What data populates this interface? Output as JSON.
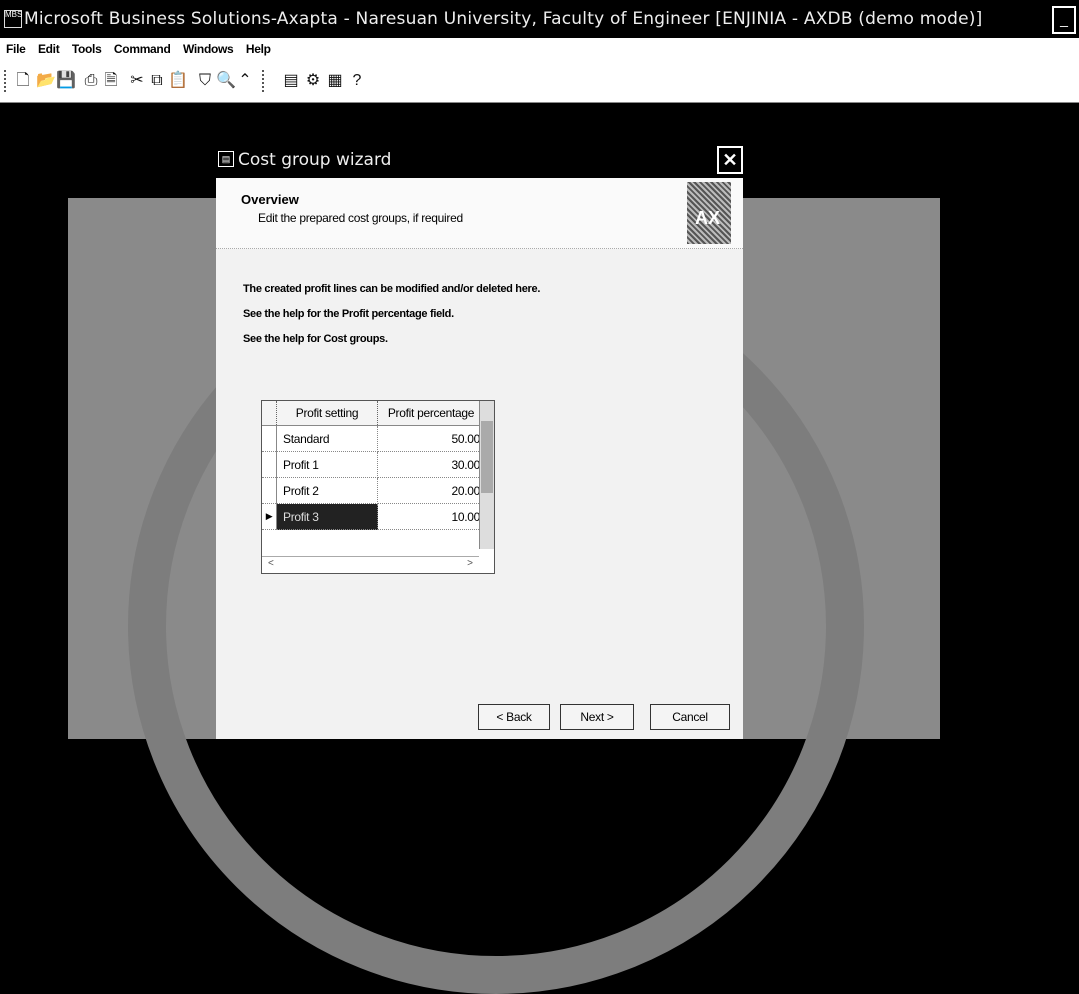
{
  "window": {
    "title": "Microsoft Business Solutions-Axapta - Naresuan University, Faculty of Engineer [ENJINIA - AXDB (demo mode)]",
    "icon_text": "MBS"
  },
  "menu": [
    "File",
    "Edit",
    "Tools",
    "Command",
    "Windows",
    "Help"
  ],
  "toolbar": {
    "buttons": [
      "new-icon",
      "open-icon",
      "save-icon",
      "print-icon",
      "print-preview-icon",
      "cut-icon",
      "copy-icon",
      "paste-icon",
      "filter-icon",
      "find-icon",
      "go-to-main-table-icon",
      "list-icon",
      "application-icon",
      "properties-icon",
      "help-icon"
    ]
  },
  "dialog": {
    "title": "Cost group wizard",
    "close_label": "✕",
    "header_title": "Overview",
    "header_subtitle": "Edit the prepared cost groups, if required",
    "logo_text": "AX",
    "lines": [
      "The created profit lines can be modified and/or deleted here.",
      "See the help for the Profit percentage field.",
      "See the help for Cost groups."
    ],
    "grid": {
      "columns": [
        "Profit setting",
        "Profit percentage"
      ],
      "rows": [
        {
          "name": "Standard",
          "pct": "50.00",
          "selected": false
        },
        {
          "name": "Profit 1",
          "pct": "30.00",
          "selected": false
        },
        {
          "name": "Profit 2",
          "pct": "20.00",
          "selected": false
        },
        {
          "name": "Profit 3",
          "pct": "10.00",
          "selected": true
        }
      ]
    },
    "buttons": {
      "back": "< Back",
      "next": "Next >",
      "cancel": "Cancel"
    }
  }
}
